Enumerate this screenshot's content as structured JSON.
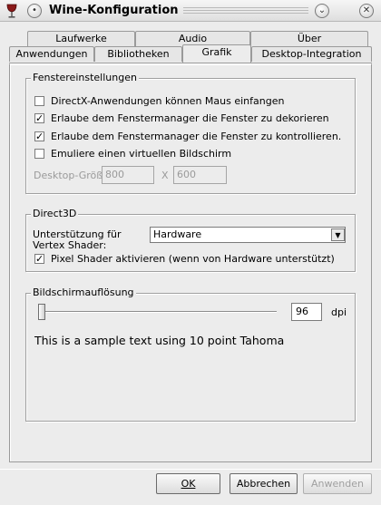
{
  "window": {
    "title": "Wine-Konfiguration"
  },
  "tabs": {
    "row1": [
      "Laufwerke",
      "Audio",
      "Über"
    ],
    "row2": [
      "Anwendungen",
      "Bibliotheken",
      "Grafik",
      "Desktop-Integration"
    ],
    "active": "Grafik"
  },
  "window_settings": {
    "title": "Fenstereinstellungen",
    "options": [
      {
        "label": "DirectX-Anwendungen können Maus einfangen",
        "checked": false
      },
      {
        "label": "Erlaube dem Fenstermanager die Fenster zu dekorieren",
        "checked": true
      },
      {
        "label": "Erlaube dem Fenstermanager die Fenster zu kontrollieren.",
        "checked": true
      },
      {
        "label": "Emuliere einen virtuellen Bildschirm",
        "checked": false
      }
    ],
    "desktop_size_label": "Desktop-Größ",
    "width_value": "800",
    "x_label": "X",
    "height_value": "600"
  },
  "direct3d": {
    "title": "Direct3D",
    "vertex_label_line1": "Unterstützung für",
    "vertex_label_line2": "Vertex Shader:",
    "vertex_value": "Hardware",
    "pixel_shader_label": "Pixel Shader aktivieren (wenn von Hardware unterstützt)",
    "pixel_shader_checked": true
  },
  "resolution": {
    "title": "Bildschirmauflösung",
    "dpi_value": "96",
    "dpi_unit": "dpi",
    "sample_text": "This is a sample text using 10 point Tahoma"
  },
  "buttons": {
    "ok": "OK",
    "cancel": "Abbrechen",
    "apply": "Anwenden"
  },
  "icons": {
    "app": "wine-glass-icon",
    "menu": "window-menu-icon",
    "collapse": "chevron-down-icon",
    "close": "close-icon"
  },
  "colors": {
    "background": "#ececec",
    "wine": "#8b1a1a"
  }
}
